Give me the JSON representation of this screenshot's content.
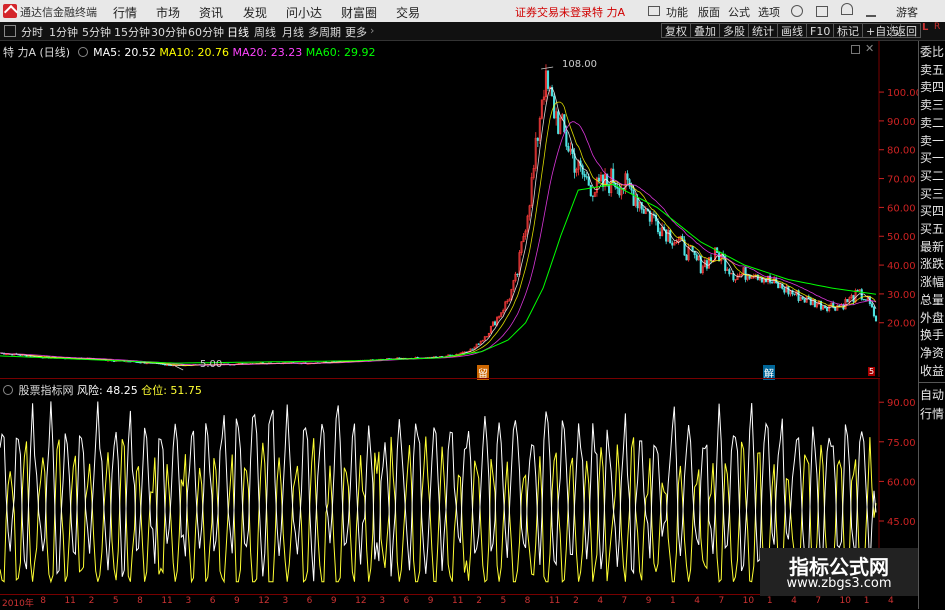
{
  "app": {
    "name": "通达信金融终端",
    "menu": [
      "行情",
      "市场",
      "资讯",
      "发现",
      "问小达",
      "财富圈",
      "交易"
    ],
    "login_notice": "证券交易未登录",
    "stock_name": "特 力A",
    "right_menu": [
      "功能",
      "版面",
      "公式",
      "选项"
    ],
    "guest": "游客"
  },
  "toolbar": {
    "periods": [
      "分时",
      "1分钟",
      "5分钟",
      "15分钟",
      "30分钟",
      "60分钟",
      "日线",
      "周线",
      "月线",
      "多周期",
      "更多"
    ],
    "active_period": "日线",
    "tools": [
      "复权",
      "叠加",
      "多股",
      "统计",
      "画线",
      "F10",
      "标记",
      "+自选",
      "返回"
    ]
  },
  "main_chart": {
    "title": "特 力A (日线)",
    "ma5_label": "MA5: 20.52",
    "ma10_label": "MA10: 20.76",
    "ma20_label": "MA20: 23.23",
    "ma60_label": "MA60: 29.92",
    "colors": {
      "ma5": "#ffffff",
      "ma10": "#ffff00",
      "ma20": "#ff40ff",
      "ma60": "#00ff00",
      "axis": "#cc2222"
    },
    "high_label": "108.00",
    "low_label": "5.00",
    "marker_1": "留",
    "marker_2": "解",
    "marker_3": "5"
  },
  "sub_chart": {
    "title": "股票指标网",
    "risk_label": "风险: 48.25",
    "position_label": "仓位: 51.75",
    "colors": {
      "risk": "#ffffff",
      "position": "#ffff33"
    }
  },
  "chart_data": [
    {
      "type": "line",
      "title": "特 力A (日线)",
      "y_ticks": [
        "100.00",
        "90.00",
        "80.00",
        "70.00",
        "60.00",
        "50.00",
        "40.00",
        "30.00",
        "20.00"
      ],
      "ylim": [
        5,
        108
      ],
      "series": [
        {
          "name": "price",
          "x": [
            0,
            5,
            10,
            15,
            20,
            25,
            30,
            35,
            40,
            45,
            50,
            52,
            54,
            55,
            56,
            57,
            58,
            59,
            60,
            61,
            62,
            64,
            66,
            68,
            70,
            72,
            74,
            76,
            78,
            80,
            82,
            84,
            86,
            88,
            90,
            92,
            94,
            96,
            98,
            99,
            100
          ],
          "values": [
            9.5,
            8.0,
            7.5,
            6.5,
            5.2,
            5.5,
            6.0,
            6.0,
            6.5,
            7.5,
            8.0,
            9.0,
            11,
            14,
            18,
            23,
            28,
            36,
            55,
            74,
            104,
            88,
            73,
            66,
            70,
            66,
            58,
            52,
            46,
            40,
            44,
            36,
            38,
            34,
            31,
            28,
            26,
            26,
            30,
            28,
            21
          ]
        },
        {
          "name": "MA60",
          "x": [
            0,
            20,
            40,
            50,
            55,
            58,
            60,
            62,
            64,
            66,
            70,
            75,
            80,
            85,
            90,
            95,
            100
          ],
          "values": [
            8.5,
            6.0,
            6.8,
            7.8,
            10,
            14,
            20,
            32,
            50,
            66,
            68,
            60,
            48,
            40,
            35,
            32,
            29.9
          ]
        }
      ]
    },
    {
      "type": "line",
      "title": "股票指标网",
      "y_ticks": [
        "90.00",
        "75.00",
        "60.00",
        "45.00",
        "30.00"
      ],
      "ylim": [
        20,
        95
      ],
      "series": [
        {
          "name": "风险",
          "last": 48.25
        },
        {
          "name": "仓位",
          "last": 51.75
        }
      ]
    }
  ],
  "time_axis": {
    "labels": [
      "2010年",
      "8",
      "11",
      "2",
      "5",
      "8",
      "11",
      "3",
      "6",
      "9",
      "12",
      "3",
      "6",
      "9",
      "12",
      "3",
      "6",
      "9",
      "11",
      "2",
      "5",
      "8",
      "11",
      "2",
      "4",
      "7",
      "9",
      "1",
      "4",
      "7",
      "10",
      "1",
      "4",
      "7",
      "10",
      "1",
      "4"
    ]
  },
  "right_panel": {
    "items": [
      "委比",
      "卖五",
      "卖四",
      "卖三",
      "卖二",
      "卖一",
      "买一",
      "买二",
      "买三",
      "买四",
      "买五",
      "最新",
      "涨跌",
      "涨幅",
      "总量",
      "外盘",
      "换手",
      "净资",
      "收益"
    ],
    "sub_items": [
      "自动",
      "行情"
    ],
    "corner_top": "L",
    "corner_top2": "R"
  },
  "watermark": {
    "line1": "指标公式网",
    "line2": "www.zbgs3.com"
  }
}
